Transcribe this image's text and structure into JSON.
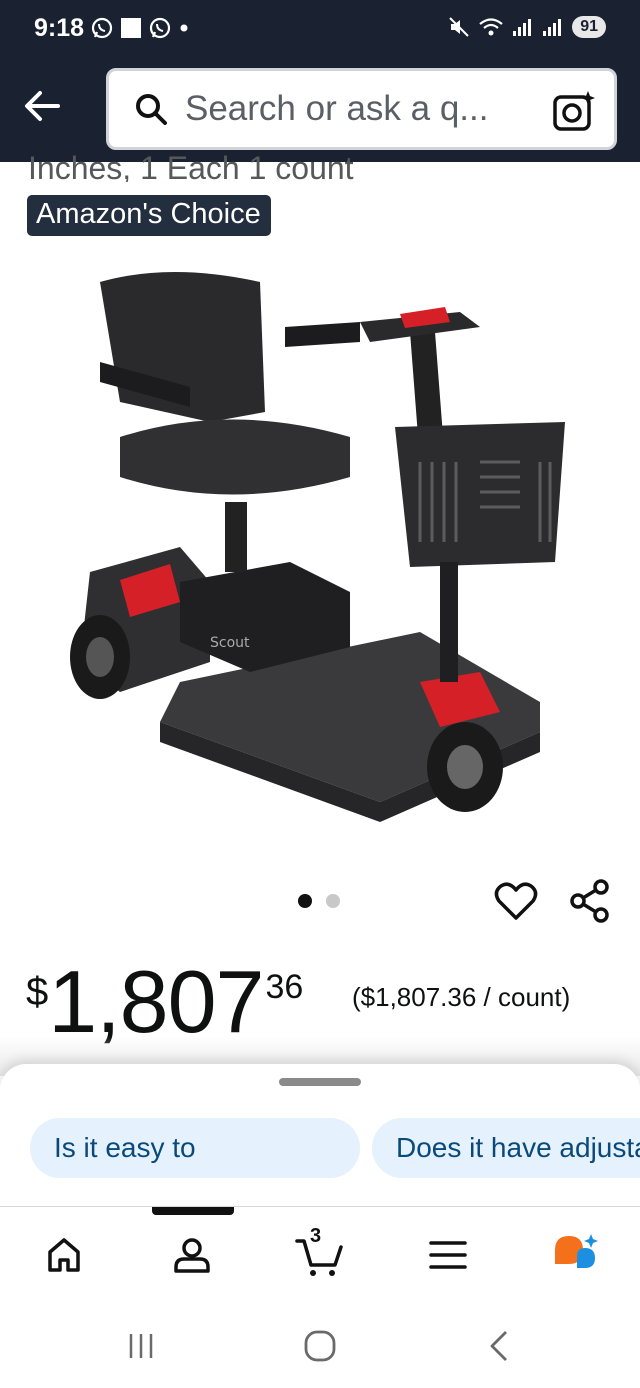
{
  "status_bar": {
    "time": "9:18",
    "battery": "91",
    "icons": [
      "whatsapp-icon",
      "square-icon",
      "whatsapp-icon",
      "dot-icon",
      "mute-icon",
      "wifi-icon",
      "signal-icon",
      "signal-icon"
    ]
  },
  "header": {
    "search_placeholder": "Search or ask a q...",
    "icons": [
      "back-arrow-icon",
      "search-icon",
      "camera-lens-icon"
    ]
  },
  "product": {
    "subtitle": "Inches, 1 Each 1 count",
    "badge": "Amazon's Choice",
    "image_label": "Scout",
    "price_currency": "$",
    "price_whole": "1,807",
    "price_fraction": "36",
    "unit_price": "($1,807.36 / count)",
    "carousel_dots": 2,
    "carousel_active": 1
  },
  "questions": {
    "chips": [
      "Is it easy to",
      "Does it have adjusta"
    ]
  },
  "bottom_nav": {
    "items": [
      "home",
      "account",
      "cart",
      "menu",
      "rufus"
    ],
    "cart_count": "3",
    "active": "account"
  },
  "colors": {
    "header_bg": "#1a2130",
    "badge_bg": "#232f3e",
    "chip_bg": "#e5f1fc",
    "chip_text": "#0a4a7a",
    "accent_orange": "#f5701a",
    "accent_blue": "#1d8fe0"
  }
}
